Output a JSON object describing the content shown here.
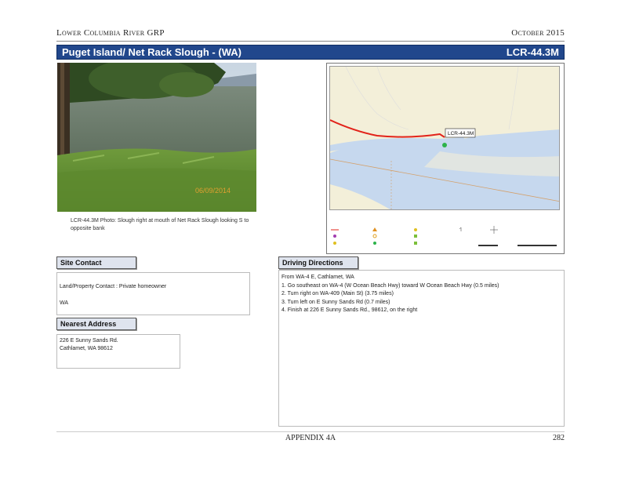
{
  "header": {
    "left": "Lower Columbia River GRP",
    "right": "October 2015"
  },
  "title": {
    "site_name": "Puget Island/ Net Rack Slough - (WA)",
    "site_code": "LCR-44.3M"
  },
  "photo": {
    "caption": "LCR-44.3M Photo: Slough right at mouth of Net Rack Slough looking S to opposite bank"
  },
  "map": {
    "site_label": "LCR-44.3M"
  },
  "site_contact": {
    "heading": "Site Contact",
    "contact_line": "Land/Property Contact : Private homeowner",
    "state": "WA"
  },
  "nearest_address": {
    "heading": "Nearest Address",
    "line1": "226 E Sunny Sands Rd.",
    "line2": "Cathlamet, WA  98612"
  },
  "driving_directions": {
    "heading": "Driving Directions",
    "from": "From WA-4 E, Cathlamet, WA",
    "steps": [
      "1. Go southeast on WA-4 (W Ocean Beach Hwy) toward W Ocean Beach Hwy (0.5 miles)",
      "2. Turn right on WA-409 (Main St) (3.75 miles)",
      "3. Turn left on E Sunny Sands Rd (0.7 miles)",
      "4. Finish at 226 E Sunny Sands Rd., 98612, on the right"
    ]
  },
  "footer": {
    "center": "APPENDIX 4A",
    "page_number": "282"
  },
  "colors": {
    "title_bar": "#21478c",
    "section_label_bg": "#dfe4ee",
    "water": "#c6d8ee",
    "land": "#f3efd9",
    "route": "#e2231a",
    "site_marker": "#2db34a"
  }
}
